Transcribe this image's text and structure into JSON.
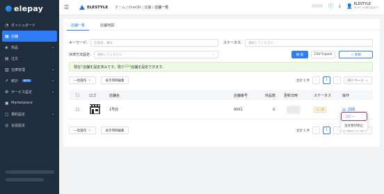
{
  "app": {
    "logo_text": "elepay"
  },
  "sidebar": {
    "items": [
      {
        "label": "ダッシュボード",
        "icon": "dashboard-icon"
      },
      {
        "label": "店舗",
        "icon": "store-icon",
        "active": true
      },
      {
        "label": "商品",
        "icon": "tag-icon",
        "expandable": true
      },
      {
        "label": "注文",
        "icon": "order-icon"
      },
      {
        "label": "在庫管理",
        "icon": "inventory-icon",
        "expandable": true
      },
      {
        "label": "統計",
        "icon": "stats-icon",
        "badge": "BETA",
        "expandable": true
      },
      {
        "label": "サービス設定",
        "icon": "gear-icon",
        "expandable": true
      },
      {
        "label": "Marketplace",
        "icon": "marketplace-icon"
      },
      {
        "label": "規約設定",
        "icon": "document-icon",
        "expandable": true
      },
      {
        "label": "言語設定",
        "icon": "globe-icon"
      }
    ]
  },
  "header": {
    "brand": "ELESTYLE",
    "breadcrumb": [
      "ホーム",
      "OneQR",
      "店舗",
      "店舗一覧"
    ],
    "user_name": "ELESTYLE",
    "user_sub": "ELESTYLE株式会社(テ..."
  },
  "tabs": [
    "店舗一覧",
    "店舗地図"
  ],
  "filters": {
    "keyword_label": "キーワード:",
    "keyword_placeholder": "店舗名、番号",
    "status_label": "ステータス:",
    "status_placeholder": "選択してください",
    "payment_label": "決済方法設定:",
    "payment_placeholder": "選択してください",
    "search_button": "検 索",
    "csv_button": "CSV Export",
    "new_button": "＋ 新規"
  },
  "notice": {
    "prefix": "現在 ",
    "count1": "0",
    "middle": " 店舗を設定済みです。残り ",
    "count2": "994",
    "suffix": " 店舗を設定できます。"
  },
  "toolbar": {
    "bulk_label": "一括操作",
    "display_label": "表示項目編集",
    "total": "合計 1 件",
    "page": "1",
    "per_page": "10 / ページ"
  },
  "table": {
    "headers": [
      "ロゴ",
      "店舗名",
      "店舗番号",
      "商品数",
      "更新日時",
      "ステータス",
      "操作"
    ],
    "rows": [
      {
        "name": "1号店",
        "number": "0001",
        "products": "0",
        "status": "未公開",
        "action": "詳細"
      }
    ]
  },
  "dropdown": {
    "items": [
      "コピー",
      "注文受付停止"
    ]
  },
  "bottom_toolbar": {
    "total": "合計 1 件",
    "page": "1",
    "per_page": "10 / ページ"
  }
}
